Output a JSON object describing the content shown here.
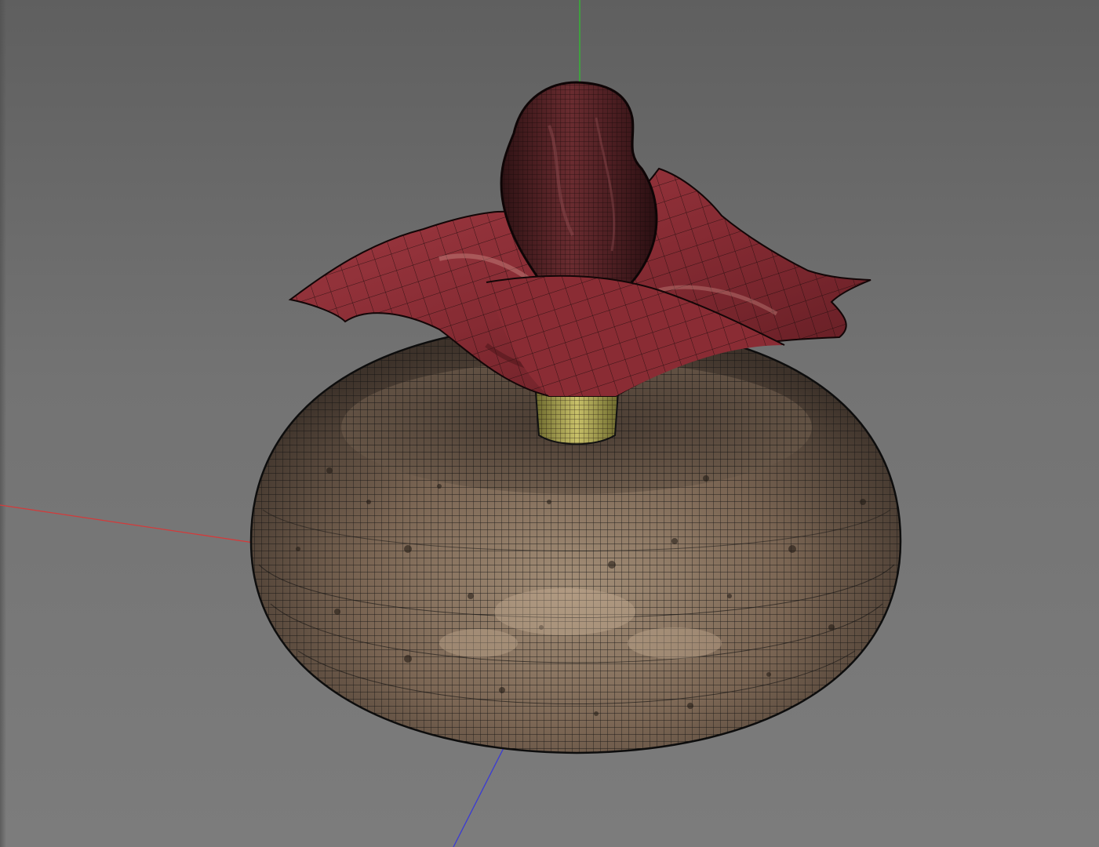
{
  "viewport": {
    "background_top": "#5f5f5f",
    "background_bottom": "#7c7c7c"
  },
  "axes": {
    "x_axis_color": "#d43a3a",
    "y_axis_color": "#2fbf2f",
    "z_axis_color": "#3a3ad4"
  },
  "model": {
    "tuber_color": "#7d6a5a",
    "spathe_color": "#8e2e36",
    "spadix_color": "#4a1f22",
    "stem_color": "#b9b04f",
    "wireframe_color": "#111111"
  }
}
